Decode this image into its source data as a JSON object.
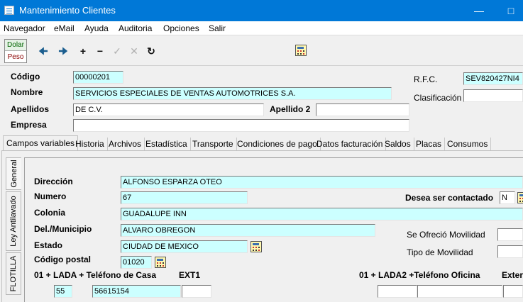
{
  "window": {
    "title": "Mantenimiento Clientes"
  },
  "menu": [
    "Navegador",
    "eMail",
    "Ayuda",
    "Auditoria",
    "Opciones",
    "Salir"
  ],
  "currency": {
    "dolar": "Dolar",
    "peso": "Peso"
  },
  "toolbar": {
    "icons": [
      "arrow-left-icon",
      "arrow-right-icon",
      "add-icon",
      "remove-icon",
      "check-icon",
      "cancel-icon",
      "refresh-icon",
      "calculator-icon"
    ]
  },
  "header": {
    "codigo_label": "Código",
    "codigo": "00000201",
    "nombre_label": "Nombre",
    "nombre": "SERVICIOS ESPECIALES DE VENTAS AUTOMOTRICES S.A.",
    "apellidos_label": "Apellidos",
    "apellidos": "DE C.V.",
    "apellido2_label": "Apellido 2",
    "apellido2": "",
    "empresa_label": "Empresa",
    "empresa": "",
    "rfc_label": "R.F.C.",
    "rfc": "SEV820427NI4",
    "clasificacion_label": "Clasificación",
    "clasificacion": ""
  },
  "tabs": [
    "Campos variables",
    "Historia",
    "Archivos",
    "Estadística",
    "Transporte",
    "Condiciones de pago",
    "Datos facturación",
    "Saldos",
    "Placas",
    "Consumos"
  ],
  "side_tabs": [
    "General",
    "Ley Antilavado",
    "FLOTILLA"
  ],
  "general": {
    "direccion_label": "Dirección",
    "direccion": "ALFONSO ESPARZA OTEO",
    "numero_label": "Numero",
    "numero": "67",
    "contactado_label": "Desea ser contactado",
    "contactado": "N",
    "colonia_label": "Colonia",
    "colonia": "GUADALUPE INN",
    "municipio_label": "Del./Municipio",
    "municipio": "ALVARO OBREGON",
    "movilidad_ofrecio_label": "Se Ofreció Movilidad",
    "movilidad_ofrecio": "",
    "estado_label": "Estado",
    "estado": "CIUDAD DE MEXICO",
    "tipo_movilidad_label": "Tipo de Movilidad",
    "tipo_movilidad": "",
    "cp_label": "Código postal",
    "cp": "01020",
    "tel_casa_label": "01 + LADA  + Teléfono de Casa",
    "ext1_label": "EXT1",
    "lada": "55",
    "tel_casa": "56615154",
    "ext1": "",
    "tel_oficina_label": "01 + LADA2 +Teléfono Oficina",
    "ext2_label": "Exter",
    "lada2": "",
    "tel_oficina": "",
    "ext2": ""
  }
}
